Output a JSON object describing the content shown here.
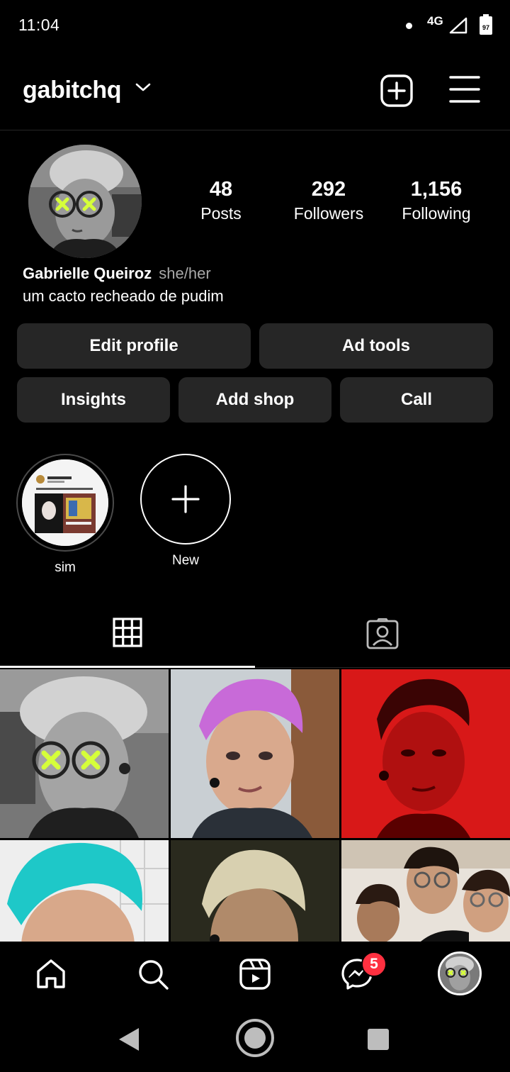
{
  "status_bar": {
    "time": "11:04",
    "network": "4G",
    "battery_level": "97"
  },
  "header": {
    "username": "gabitchq",
    "icons": [
      "chevron-down-icon",
      "new-post-icon",
      "menu-icon"
    ]
  },
  "profile": {
    "stats": {
      "posts_value": "48",
      "posts_label": "Posts",
      "followers_value": "292",
      "followers_label": "Followers",
      "following_value": "1,156",
      "following_label": "Following"
    },
    "name": "Gabrielle Queiroz",
    "pronouns": "she/her",
    "bio": "um cacto recheado de pudim"
  },
  "buttons": {
    "edit_profile": "Edit profile",
    "ad_tools": "Ad tools",
    "insights": "Insights",
    "add_shop": "Add shop",
    "call": "Call"
  },
  "highlights": [
    {
      "label": "sim"
    },
    {
      "label": "New"
    }
  ],
  "tabs": [
    "grid-icon",
    "tagged-icon"
  ],
  "bottom_nav": {
    "items": [
      "home-icon",
      "search-icon",
      "reels-icon",
      "messenger-icon",
      "profile-avatar"
    ],
    "messenger_badge": "5"
  },
  "colors": {
    "background": "#000000",
    "button_bg": "#262626",
    "secondary_text": "#a8a8a8",
    "badge": "#ff3040"
  }
}
